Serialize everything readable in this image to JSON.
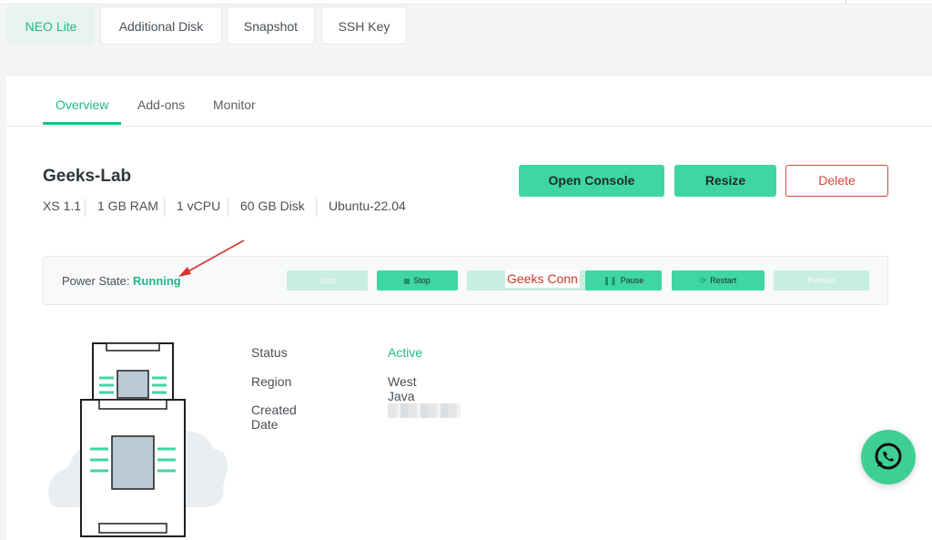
{
  "top_tabs": [
    {
      "label": "NEO Lite",
      "active": true
    },
    {
      "label": "Additional Disk",
      "active": false
    },
    {
      "label": "Snapshot",
      "active": false
    },
    {
      "label": "SSH Key",
      "active": false
    }
  ],
  "sub_tabs": [
    {
      "label": "Overview",
      "active": true
    },
    {
      "label": "Add-ons",
      "active": false
    },
    {
      "label": "Monitor",
      "active": false
    }
  ],
  "instance": {
    "name": "Geeks-Lab",
    "specs": [
      "XS 1.1",
      "1 GB RAM",
      "1 vCPU",
      "60 GB Disk",
      "Ubuntu-22.04"
    ]
  },
  "actions": {
    "open_console": "Open Console",
    "resize": "Resize",
    "delete": "Delete"
  },
  "power": {
    "label": "Power State: ",
    "state": "Running",
    "buttons": [
      {
        "label": "Start",
        "enabled": false
      },
      {
        "label": "Stop",
        "enabled": true
      },
      {
        "label": "Pause",
        "enabled": true
      },
      {
        "label": "Restart",
        "enabled": true
      },
      {
        "label": "Rebuild",
        "enabled": false
      }
    ],
    "overlay_text": "Geeks Conn"
  },
  "details": {
    "status_label": "Status",
    "status_value": "Active",
    "region_label": "Region",
    "region_value": "West Java",
    "created_label": "Created Date"
  },
  "colors": {
    "accent": "#1fb98a",
    "button_green": "#3fd6a2",
    "danger": "#d0493c",
    "annotation_red": "#d4342c"
  },
  "icons": {
    "fab": "whatsapp-icon",
    "illustration": "server-icon"
  }
}
